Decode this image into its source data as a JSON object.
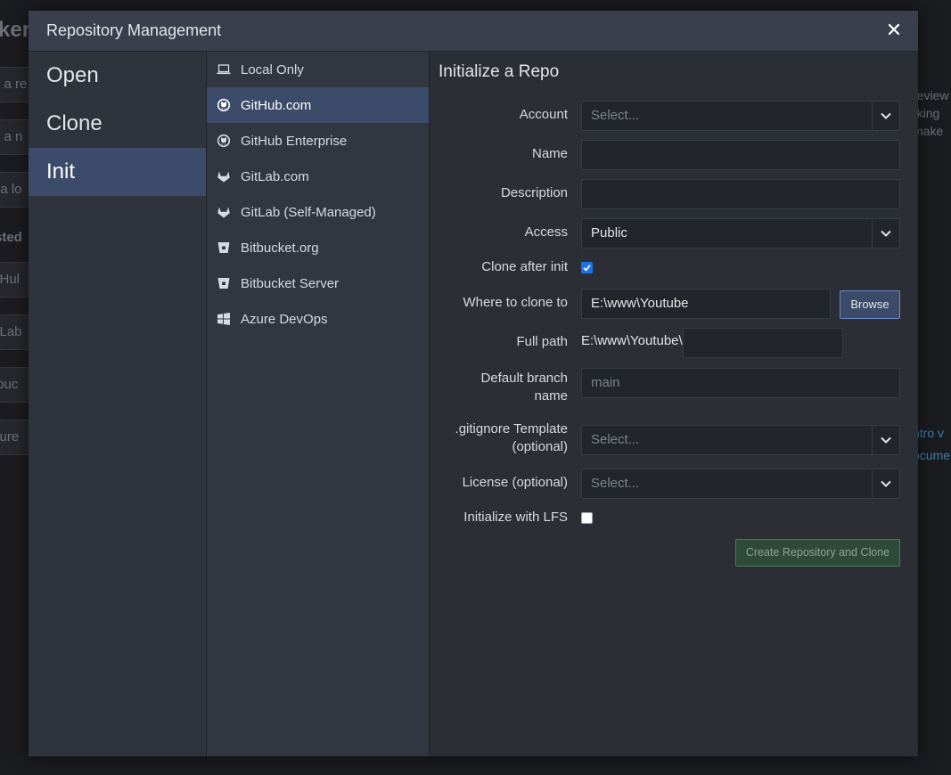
{
  "background": {
    "title_fragment": "ker",
    "left_fragments": [
      "n a re",
      "e a n",
      "t a lo"
    ],
    "section_fragment": "sted",
    "provider_fragments": [
      "itHul",
      "itLab",
      "tbuc",
      "zure"
    ],
    "right_texts": [
      "review",
      "rking",
      "make"
    ],
    "right_links": [
      "ntro v",
      "ocume"
    ]
  },
  "dialog": {
    "title": "Repository Management",
    "close_label": "✕"
  },
  "nav": {
    "items": [
      {
        "label": "Open",
        "active": false
      },
      {
        "label": "Clone",
        "active": false
      },
      {
        "label": "Init",
        "active": true
      }
    ]
  },
  "providers": {
    "items": [
      {
        "label": "Local Only",
        "icon": "laptop-icon",
        "active": false
      },
      {
        "label": "GitHub.com",
        "icon": "github-icon",
        "active": true
      },
      {
        "label": "GitHub Enterprise",
        "icon": "github-icon",
        "active": false
      },
      {
        "label": "GitLab.com",
        "icon": "gitlab-icon",
        "active": false
      },
      {
        "label": "GitLab (Self-Managed)",
        "icon": "gitlab-icon",
        "active": false
      },
      {
        "label": "Bitbucket.org",
        "icon": "bitbucket-icon",
        "active": false
      },
      {
        "label": "Bitbucket Server",
        "icon": "bitbucket-icon",
        "active": false
      },
      {
        "label": "Azure DevOps",
        "icon": "windows-icon",
        "active": false
      }
    ]
  },
  "form": {
    "heading": "Initialize a Repo",
    "account": {
      "label": "Account",
      "placeholder": "Select..."
    },
    "name": {
      "label": "Name",
      "value": ""
    },
    "description": {
      "label": "Description",
      "value": ""
    },
    "access": {
      "label": "Access",
      "value": "Public"
    },
    "clone_after_init": {
      "label": "Clone after init",
      "checked": true
    },
    "where_to_clone": {
      "label": "Where to clone to",
      "value": "E:\\www\\Youtube",
      "browse_label": "Browse"
    },
    "full_path": {
      "label": "Full path",
      "prefix": "E:\\www\\Youtube\\",
      "value": ""
    },
    "default_branch": {
      "label_line1": "Default branch",
      "label_line2": "name",
      "placeholder": "main"
    },
    "gitignore": {
      "label_line1": ".gitignore Template",
      "label_line2": "(optional)",
      "placeholder": "Select..."
    },
    "license": {
      "label": "License (optional)",
      "placeholder": "Select..."
    },
    "lfs": {
      "label": "Initialize with LFS",
      "checked": false
    },
    "submit_label": "Create Repository and Clone"
  },
  "colors": {
    "active_bg": "#3d4b6a",
    "checkbox_on": "#1a73e8",
    "create_btn_bg": "#2e4a39"
  }
}
